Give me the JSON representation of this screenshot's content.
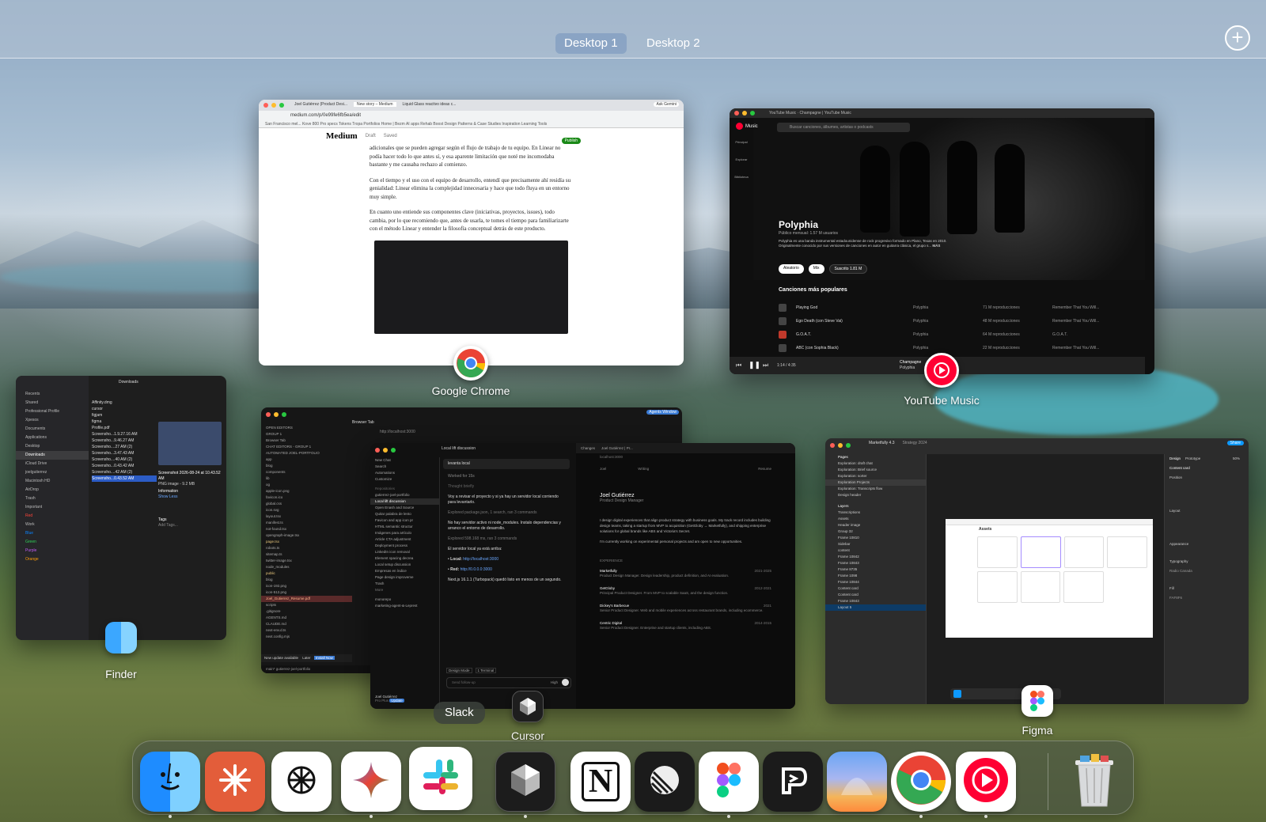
{
  "spaces": {
    "tabs": [
      "Desktop 1",
      "Desktop 2"
    ],
    "active": "Desktop 1",
    "add_label": "+"
  },
  "chrome_window": {
    "app_label": "Google Chrome",
    "tabs": [
      "Joel Gutiérrez (Product Desi...",
      "New story – Medium",
      "Liquid Glass reactivo ideas c..."
    ],
    "ask_gemini": "Ask Gemini",
    "url": "medium.com/p/0e99fe6fb5ea/edit",
    "bookmarks": "San Francisco mel...   Kove 800 Pro specs   Tokens   Tropa   Portfolios   Home | Bezm   AI apps   Rehab Boost   Design Patterns &   Case Studies   Inspiration   Learning   Tools",
    "medium_logo": "Medium",
    "draft": "Draft",
    "saved": "Saved",
    "publish": "Publish",
    "paragraphs": [
      "adicionales que se pueden agregar según el flujo de trabajo de tu equipo. En Linear no podía hacer todo lo que antes sí, y esa aparente limitación que noté me incomodaba bastante y me causaba rechazo al comienzo.",
      "Con el tiempo y el uso con el equipo de desarrollo, entendí que precisamente ahí residía su genialidad: Linear elimina la complejidad innecesaria y hace que todo fluya en un entorno muy simple.",
      "En cuanto uno entiende sus componentes clave (iniciativas, proyectos, issues), todo cambia, por lo que recomiendo que, antes de usarla, te tomes el tiempo para familiarizarte con el método Linear y entender la filosofía conceptual detrás de este producto."
    ]
  },
  "yt_window": {
    "app_label": "YouTube Music",
    "titlebar": "YouTube Music · Champagne | YouTube Music",
    "logo": "Music",
    "search_placeholder": "Buscar canciones, álbumes, artistas o podcasts",
    "nav": [
      "Principal",
      "Explorar",
      "Biblioteca"
    ],
    "artist": "Polyphia",
    "listeners": "Público mensual: 1.57 M usuarios",
    "description": "Polyphia es una banda instrumental estadounidense de rock progresivo formado en Plano, Texas en 2010. Originalmente conocido por sus versiones de canciones en autor en guitarra clásica, el grupo s...",
    "more": "MÁS",
    "buttons": [
      "Aleatorio",
      "Mix",
      "Suscrito 1.81 M"
    ],
    "section": "Canciones más populares",
    "songs": [
      {
        "title": "Playing God",
        "artist": "Polyphia",
        "plays": "71 M reproducciones",
        "album": "Remember That You Will..."
      },
      {
        "title": "Ego Death (con Steve Vai)",
        "artist": "Polyphia",
        "plays": "48 M reproducciones",
        "album": "Remember That You Will..."
      },
      {
        "title": "G.O.A.T.",
        "artist": "Polyphia",
        "plays": "64 M reproducciones",
        "album": "G.O.A.T."
      },
      {
        "title": "ABC (con Sophia Black)",
        "artist": "Polyphia",
        "plays": "22 M reproducciones",
        "album": "Remember That You Will..."
      }
    ],
    "player_time": "1:14 / 4:35",
    "player_track": "Champagne",
    "player_artist": "Polyphia"
  },
  "finder_window": {
    "app_label": "Finder",
    "folder": "Downloads",
    "sidebar": [
      "Recents",
      "Shared",
      "Professional Profile",
      "Xpesos",
      "Documents",
      "Applications",
      "Desktop",
      "Downloads",
      "iCloud Drive",
      "joelgutierrez",
      "Macintosh HD",
      "AirDrop",
      "Trash",
      "Important",
      "Red",
      "Work",
      "Blue",
      "Green",
      "Purple",
      "Orange"
    ],
    "files": [
      "Affinity.dmg",
      "cursor",
      "figjam",
      "figma",
      "Profile.pdf",
      "Screensho...1.9.27.16 AM",
      "Screensho...9.46.27 AM",
      "Screensho....27 AM (2)",
      "Screensho...3.47.43 AM",
      "Screensho....40 AM (2)",
      "Screensho...0.43.42 AM",
      "Screensho....42 AM (2)",
      "Screensho...0.43.52 AM"
    ],
    "preview_title": "Screenshot 2026-08-24 at 10.43.52 AM",
    "preview_meta": "PNG image - 9.2 MB",
    "information": "Information",
    "show_less": "Show Less",
    "tags": "Tags",
    "add_tags": "Add Tags..."
  },
  "cursor_window": {
    "app_label": "Cursor",
    "browser_tab": "Browser Tab",
    "url": "http://localhost:3000",
    "agents": "Agents Window",
    "explorer": [
      "OPEN EDITORS",
      "GROUP 1",
      "Browser Tab",
      "CHAT EDITORS - GROUP 1",
      "AUTOMATED JOEL-PORTFOLIO",
      "app",
      "blog",
      "components",
      "lib",
      "og",
      "apple-icon.png",
      "favicon.ico",
      "global.css",
      "icon.svg",
      "layout.tsx",
      "manifest.ts",
      "not-found.tsx",
      "opengraph-image.tsx",
      "page.tsx",
      "robots.ts",
      "sitemap.ts",
      "twitter-image.tsx",
      "node_modules",
      "public",
      "blog",
      "icon-192.png",
      "icon-512.png",
      "Joel_Gutierrez_Resume.pdf",
      "scripts",
      ".gitignore",
      "AGENTS.md",
      "CLAUDE.md",
      "next-env.d.ts",
      "next.config.mjs"
    ],
    "update": "New update available",
    "later": "Later",
    "install": "Install Now",
    "status": "main*   gutierrez-joel-portfolio"
  },
  "agent_window": {
    "menu": [
      "New Chat",
      "Search",
      "Automations",
      "Customize"
    ],
    "repos_header": "Repositories",
    "repo": "gutierrez-joel-portfolio",
    "threads": [
      "Local lift discussion",
      "Open Enash and Source",
      "Quitar palabra de lento",
      "Favicon and app icon pr",
      "HTML semantic structur",
      "Imágenes para artículo",
      "Article CTA adjustment",
      "Deployment process",
      "LinkedIn icon removal",
      "Element spacing decrea",
      "Local setup discussion",
      "Empresas en índice",
      "Page design improveme",
      "Trash"
    ],
    "more": "More",
    "repos2": [
      "monorepo",
      "marketing-agent-&-Leprest"
    ],
    "user": "Joel Gutiérrez",
    "plan": "Pro Plus",
    "update_badge": "Update",
    "chat_title": "Local lift discussion",
    "prompt": "levanta local",
    "worked": "Worked for 15s",
    "thought": "Thought briefly",
    "msg1": "Voy a revisar el proyecto y si ya hay un servidor local corriendo para levantarlo.",
    "explored1": "Explored package.json, 1 search, ran 3 commands",
    "msg2": "No hay servidor activo ni node_modules. Instalo dependencias y arranco el entorno de desarrollo.",
    "explored2": "Explored 598.168 ms, ran 3 commands",
    "msg3": "El servidor local ya está arriba:",
    "local_label": "Local:",
    "local_url": "http://localhost:3000",
    "red_label": "Red:",
    "red_url": "http://0.0.0.0:3000",
    "msg4": "Next.js 16.1.1 (Turbopack) quedó listo en menos de un segundo.",
    "mode": "Design Mode",
    "terminal": "1 Terminal",
    "send_placeholder": "Send follow-up",
    "model": "High"
  },
  "site_window": {
    "tab": "Joel Gutiérrez | Pr...",
    "changes": "Changes",
    "url": "localhost:3000",
    "nav": [
      "Joel",
      "Writing",
      "Resume"
    ],
    "name": "Joel Gutiérrez",
    "role": "Product Design Manager",
    "bio1": "I design digital experiences that align product strategy with business goals. My track record includes building design teams, taking a startup from MVP to acquisition (GetGloby → Marketfully), and shipping enterprise solutions for global brands like ABS and Victoria's Secret.",
    "bio2": "I'm currently working on experimental personal projects and am open to new opportunities.",
    "experience": "Experience",
    "jobs": [
      {
        "company": "Marketfully",
        "years": "2021-2025",
        "desc": "Product Design Manager. Design leadership, product definition, and AI evaluation."
      },
      {
        "company": "GetGloby",
        "years": "2012-2021",
        "desc": "Principal Product Designer. From MVP to scalable SaaS, and the design function."
      },
      {
        "company": "Dickey's Barbecue",
        "years": "2021",
        "desc": "Senior Product Designer. Web and mobile experiences across restaurant brands, including ecommerce."
      },
      {
        "company": "Centric Digital",
        "years": "2014-2015",
        "desc": "Senior Product Designer. Enterprise and startup clients, including ABS."
      }
    ]
  },
  "figma_window": {
    "app_label": "Figma",
    "file_tab": "Marketfully 4.3",
    "file_tab2": "Strategy 2024",
    "share": "Share",
    "pages_header": "Pages",
    "pages": [
      "Exploration: draft chat",
      "Exploration: Brief source",
      "Exploration: sorter",
      "Exploration Projects",
      "Exploration: Transcripts flow",
      "Design header"
    ],
    "layers_header": "Layers",
    "layers": [
      "Transcriptions",
      "Assets",
      "Header image",
      "Group 32",
      "Frame 10810",
      "Sidebar",
      "content",
      "Frame 10842",
      "Frame 10843",
      "Frame 8735",
      "Frame 1098",
      "Frame 10844",
      "Content card",
      "Content card",
      "Frame 10843",
      "Layout 5"
    ],
    "frame_title": "Assets",
    "right_tabs": [
      "Design",
      "Prototype"
    ],
    "zoom": "50%",
    "right_sections": [
      "Content card",
      "Position",
      "Layout",
      "Appearance",
      "Typography",
      "Fill"
    ],
    "font": "Radio Canada",
    "fill_value": "FAF8F6"
  },
  "dock": {
    "tooltip": "Slack",
    "apps": [
      {
        "name": "Finder",
        "icon": "finder-icon",
        "running": true
      },
      {
        "name": "Claude",
        "icon": "claude-icon",
        "running": false
      },
      {
        "name": "ChatGPT",
        "icon": "chatgpt-icon",
        "running": false
      },
      {
        "name": "Gemini",
        "icon": "gemini-icon",
        "running": true
      },
      {
        "name": "Slack",
        "icon": "slack-icon",
        "running": false
      },
      {
        "name": "Cursor",
        "icon": "cursor-icon",
        "running": true
      },
      {
        "name": "Notion",
        "icon": "notion-icon",
        "running": false
      },
      {
        "name": "Linear",
        "icon": "linear-icon",
        "running": false
      },
      {
        "name": "Figma",
        "icon": "figma-icon",
        "running": true
      },
      {
        "name": "Prompt",
        "icon": "prompt-icon",
        "running": false
      },
      {
        "name": "Arc Weather",
        "icon": "weather-icon",
        "running": false
      },
      {
        "name": "Google Chrome",
        "icon": "chrome-icon",
        "running": true
      },
      {
        "name": "YouTube Music",
        "icon": "youtube-music-icon",
        "running": true
      },
      {
        "name": "Trash",
        "icon": "trash-icon",
        "running": false
      }
    ]
  },
  "colors": {
    "chrome_red": "#ea4335",
    "chrome_yellow": "#fbbc05",
    "chrome_green": "#34a853",
    "chrome_blue": "#4285f4",
    "yt_red": "#ff0033",
    "figma_accent": "#0d99ff",
    "medium_green": "#1a8917"
  }
}
